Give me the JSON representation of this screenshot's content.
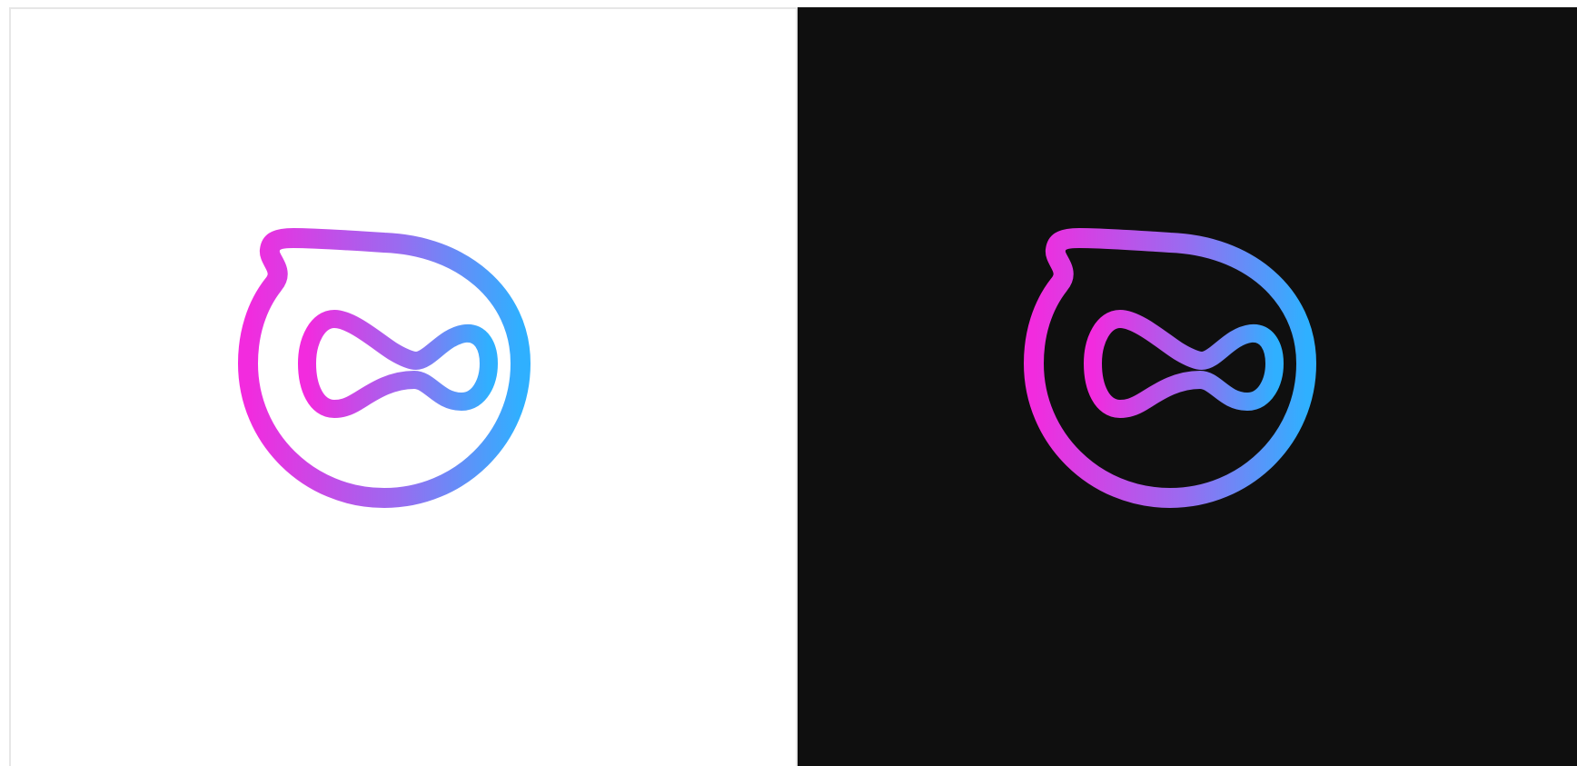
{
  "panels": [
    {
      "id": "light",
      "background": "#ffffff",
      "logo": "infinity-blob-logo-icon"
    },
    {
      "id": "dark",
      "background": "#0f0f0f",
      "logo": "infinity-blob-logo-icon"
    }
  ],
  "colors": {
    "gradient_start": "#f22bde",
    "gradient_mid": "#9a6bf0",
    "gradient_end": "#2fb0ff",
    "light_background": "#ffffff",
    "dark_background": "#0f0f0f",
    "divider": "#e6e6e6"
  }
}
